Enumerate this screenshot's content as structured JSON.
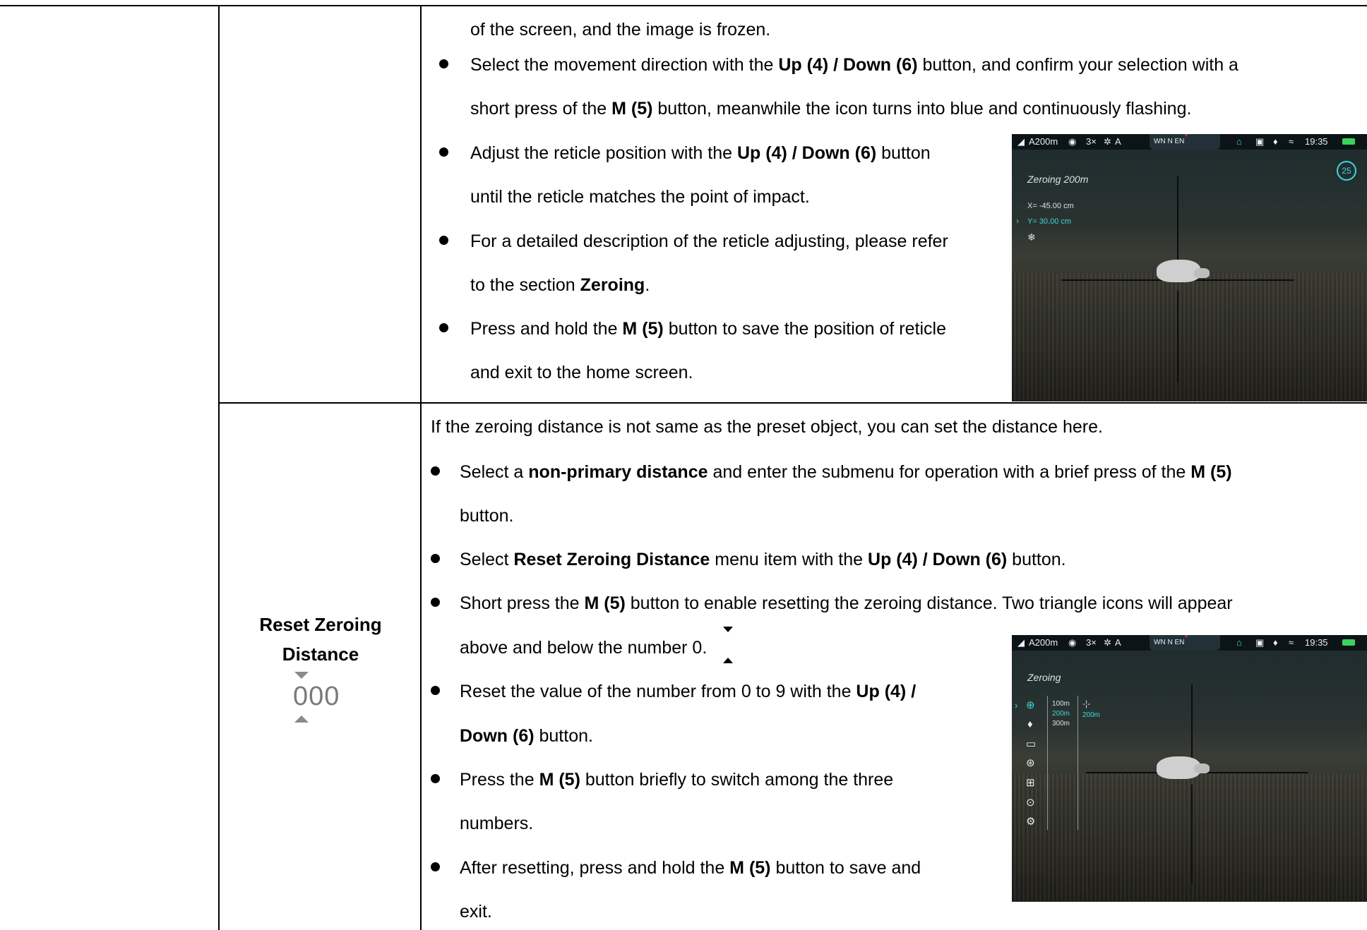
{
  "top_row": {
    "continuation": "of the screen, and the image is frozen.",
    "bullets": [
      {
        "parts": [
          [
            "Select the movement direction with the ",
            false
          ],
          [
            "Up (4) / Down (6)",
            true
          ],
          [
            " button, and confirm your selection with a",
            false
          ]
        ]
      },
      {
        "parts": [
          [
            "short press of the ",
            false
          ],
          [
            "M (5)",
            true
          ],
          [
            " button, meanwhile the icon turns into blue and continuously flashing.",
            false
          ]
        ]
      },
      {
        "parts": [
          [
            "Adjust the reticle position with the ",
            false
          ],
          [
            "Up (4) / Down (6)",
            true
          ],
          [
            " button",
            false
          ]
        ]
      },
      {
        "parts": [
          [
            "until the reticle matches the point of impact.",
            false
          ]
        ]
      },
      {
        "parts": [
          [
            "For a detailed description of the reticle adjusting, please refer",
            false
          ]
        ]
      },
      {
        "parts": [
          [
            "to the section ",
            false
          ],
          [
            "Zeroing",
            true
          ],
          [
            ".",
            false
          ]
        ]
      },
      {
        "parts": [
          [
            "Press and hold the ",
            false
          ],
          [
            "M (5)",
            true
          ],
          [
            " button to save the position of reticle",
            false
          ]
        ]
      },
      {
        "parts": [
          [
            "and exit to the home screen.",
            false
          ]
        ]
      }
    ],
    "screen": {
      "status": {
        "rangefinder": "A200m",
        "zoom": "3×",
        "mode": "A",
        "compass": "WN  N  EN",
        "time": "19:35"
      },
      "title": "Zeroing 200m",
      "x_value": "X= -45.00 cm",
      "y_value": "Y= 30.00 cm",
      "badge": "25"
    }
  },
  "bottom_row": {
    "label_line1": "Reset Zeroing",
    "label_line2": "Distance",
    "label_digits": "000",
    "intro": "If the zeroing distance is not same as the preset object, you can set the distance here.",
    "lines": [
      {
        "parts": [
          [
            "Select a ",
            false
          ],
          [
            "non-primary distance",
            true
          ],
          [
            " and enter the submenu for operation with a brief press of the ",
            false
          ],
          [
            "M (5)",
            true
          ]
        ]
      },
      {
        "parts": [
          [
            "button.",
            false
          ]
        ]
      },
      {
        "parts": [
          [
            "Select ",
            false
          ],
          [
            "Reset Zeroing Distance",
            true
          ],
          [
            " menu item with the ",
            false
          ],
          [
            "Up (4) / Down (6)",
            true
          ],
          [
            " button.",
            false
          ]
        ]
      },
      {
        "parts": [
          [
            "Short press the ",
            false
          ],
          [
            "M (5)",
            true
          ],
          [
            " button to enable resetting the zeroing distance. Two triangle icons will appear",
            false
          ]
        ]
      },
      {
        "parts": [
          [
            "above and below the number ",
            false
          ],
          [
            "0",
            false
          ],
          [
            ".",
            false
          ]
        ]
      },
      {
        "parts": [
          [
            "Reset the value of the number from 0 to 9 with the ",
            false
          ],
          [
            "Up (4) /",
            true
          ]
        ]
      },
      {
        "parts": [
          [
            "Down (6)",
            true
          ],
          [
            " button.",
            false
          ]
        ]
      },
      {
        "parts": [
          [
            "Press the ",
            false
          ],
          [
            "M (5)",
            true
          ],
          [
            " button briefly to switch among the three",
            false
          ]
        ]
      },
      {
        "parts": [
          [
            "numbers.",
            false
          ]
        ]
      },
      {
        "parts": [
          [
            "After resetting, press and hold the ",
            false
          ],
          [
            "M (5)",
            true
          ],
          [
            " button to save and",
            false
          ]
        ]
      },
      {
        "parts": [
          [
            "exit.",
            false
          ]
        ]
      }
    ],
    "screen": {
      "status": {
        "rangefinder": "A200m",
        "zoom": "3×",
        "mode": "A",
        "compass": "WN  N  EN",
        "time": "19:35"
      },
      "title": "Zeroing",
      "distances": [
        "100m",
        "200m",
        "300m"
      ],
      "selected_distance": "200m"
    }
  }
}
